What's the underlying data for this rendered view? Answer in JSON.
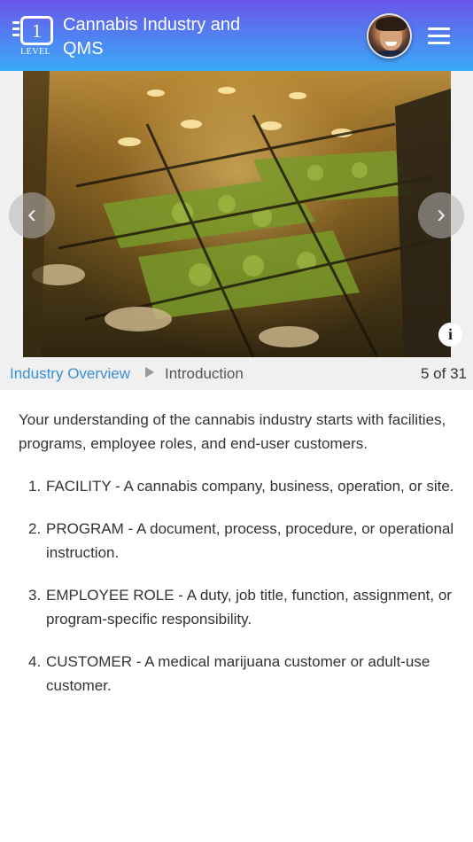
{
  "header": {
    "logo_number": "1",
    "logo_caption": "LEVEL",
    "title": "Cannabis Industry and QMS",
    "avatar_icon": "user-avatar",
    "menu_icon": "hamburger-menu-icon"
  },
  "image": {
    "prev_icon": "chevron-left-icon",
    "next_icon": "chevron-right-icon",
    "info_label": "i"
  },
  "breadcrumb": {
    "section": "Industry Overview",
    "current": "Introduction",
    "page_count": "5 of 31"
  },
  "content": {
    "intro": "Your understanding of the cannabis industry starts with facilities, programs, employee roles, and end-user customers.",
    "items": [
      {
        "number": "1.",
        "text": "FACILITY - A cannabis company, business, operation, or site."
      },
      {
        "number": "2.",
        "text": "PROGRAM - A document, process, procedure, or operational instruction."
      },
      {
        "number": "3.",
        "text": "EMPLOYEE ROLE - A duty, job title, function, assignment, or program-specific responsibility."
      },
      {
        "number": "4.",
        "text": "CUSTOMER - A medical marijuana customer or adult-use customer."
      }
    ]
  },
  "colors": {
    "header_gradient_top": "#6a55ea",
    "header_gradient_bottom": "#3aaaf6",
    "link": "#3a8fd6",
    "bar_background": "#f0f0f0"
  }
}
